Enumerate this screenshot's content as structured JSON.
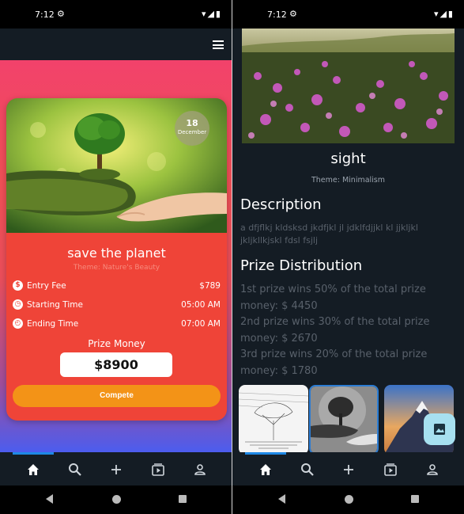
{
  "status_bar": {
    "time": "7:12"
  },
  "left": {
    "card": {
      "date_day": "18",
      "date_month": "December",
      "title": "save the planet",
      "theme": "Theme: Nature's Beauty",
      "entry_fee_label": "Entry Fee",
      "entry_fee_value": "$789",
      "start_label": "Starting Time",
      "start_value": "05:00 AM",
      "end_label": "Ending Time",
      "end_value": "07:00 AM",
      "prize_label": "Prize Money",
      "prize_value": "$8900",
      "compete_label": "Compete"
    }
  },
  "right": {
    "title": "sight",
    "theme": "Theme: Minimalism",
    "description_heading": "Description",
    "description_text": "a dfjflkj kldsksd jkdfjkl jl jdklfdjjkl kl jjkljkl jkljkllkjskl fdsl fsjlj",
    "prize_heading": "Prize Distribution",
    "prize_lines": [
      "1st prize wins 50% of the total prize money: $ 4450",
      "2nd prize wins 30% of the total prize money: $ 2670",
      "3rd prize wins 20% of the total prize money: $ 1780"
    ]
  },
  "bottom_tabs": [
    "home-icon",
    "search-icon",
    "plus-icon",
    "video-library-icon",
    "profile-icon"
  ],
  "colors": {
    "card_red": "#ef4438",
    "compete_orange": "#f39317",
    "accent_blue": "#1e88e5",
    "fab_bg": "#a7e0f0",
    "dark_bg": "#141c24"
  }
}
